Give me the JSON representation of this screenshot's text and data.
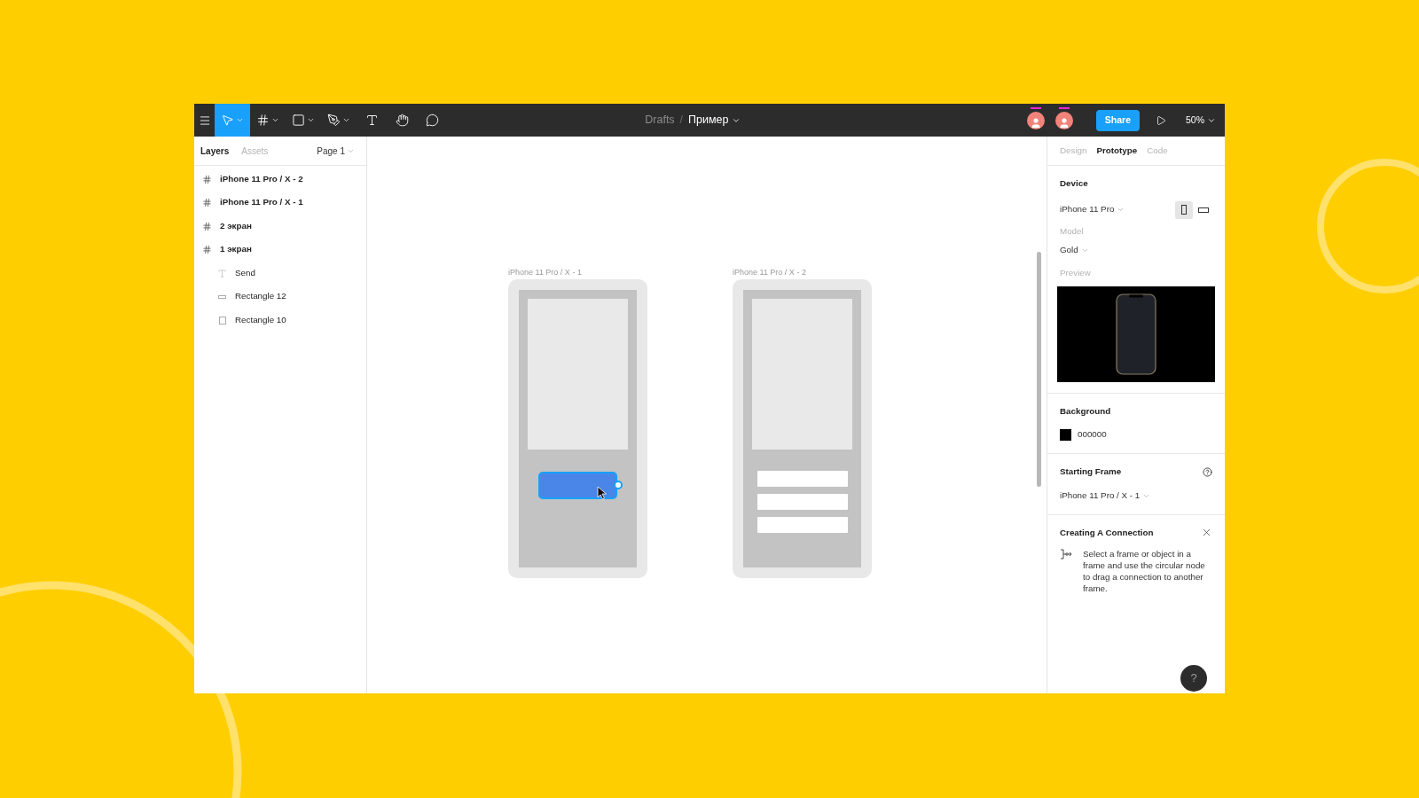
{
  "toolbar": {
    "tools": [
      {
        "kind": "move",
        "selected": true
      },
      {
        "kind": "frame",
        "selected": false
      },
      {
        "kind": "shape",
        "selected": false
      },
      {
        "kind": "pen",
        "selected": false
      },
      {
        "kind": "text",
        "selected": false
      },
      {
        "kind": "hand",
        "selected": false
      },
      {
        "kind": "comment",
        "selected": false
      }
    ],
    "breadcrumb": {
      "folder": "Drafts",
      "separator": "/",
      "file": "Пример"
    },
    "share": "Share",
    "zoom": "50%"
  },
  "layers_panel": {
    "tabs": [
      {
        "label": "Layers",
        "selected": true
      },
      {
        "label": "Assets",
        "selected": false
      }
    ],
    "page": "Page 1",
    "layers": [
      {
        "kind": "frame",
        "name": "iPhone 11 Pro / X - 2"
      },
      {
        "kind": "frame",
        "name": "iPhone 11 Pro / X - 1"
      },
      {
        "kind": "frame",
        "name": "2 экран"
      },
      {
        "kind": "frame",
        "name": "1 экран",
        "children": [
          {
            "kind": "text",
            "name": "Send"
          },
          {
            "kind": "bar",
            "name": "Rectangle 12"
          },
          {
            "kind": "rectangle",
            "name": "Rectangle 10"
          }
        ]
      }
    ]
  },
  "canvas": {
    "frames": [
      {
        "label": "iPhone 11 Pro / X - 1",
        "kind": "button-screen"
      },
      {
        "label": "iPhone 11 Pro / X - 2",
        "kind": "list-screen"
      }
    ]
  },
  "inspector": {
    "tabs": [
      {
        "label": "Design",
        "selected": false
      },
      {
        "label": "Prototype",
        "selected": true
      },
      {
        "label": "Code",
        "selected": false
      }
    ],
    "device": {
      "heading": "Device",
      "value": "iPhone 11 Pro",
      "orientations": [
        {
          "kind": "portrait",
          "selected": true
        },
        {
          "kind": "landscape",
          "selected": false
        }
      ],
      "model_label": "Model",
      "model": "Gold",
      "preview_label": "Preview"
    },
    "background": {
      "heading": "Background",
      "color": "#000000",
      "value": "000000"
    },
    "starting_frame": {
      "heading": "Starting Frame",
      "value": "iPhone 11 Pro / X - 1"
    },
    "connection": {
      "heading": "Creating A Connection",
      "text": "Select a frame or object in a frame and use the circular node to drag a connection to another frame."
    },
    "help": "?"
  }
}
